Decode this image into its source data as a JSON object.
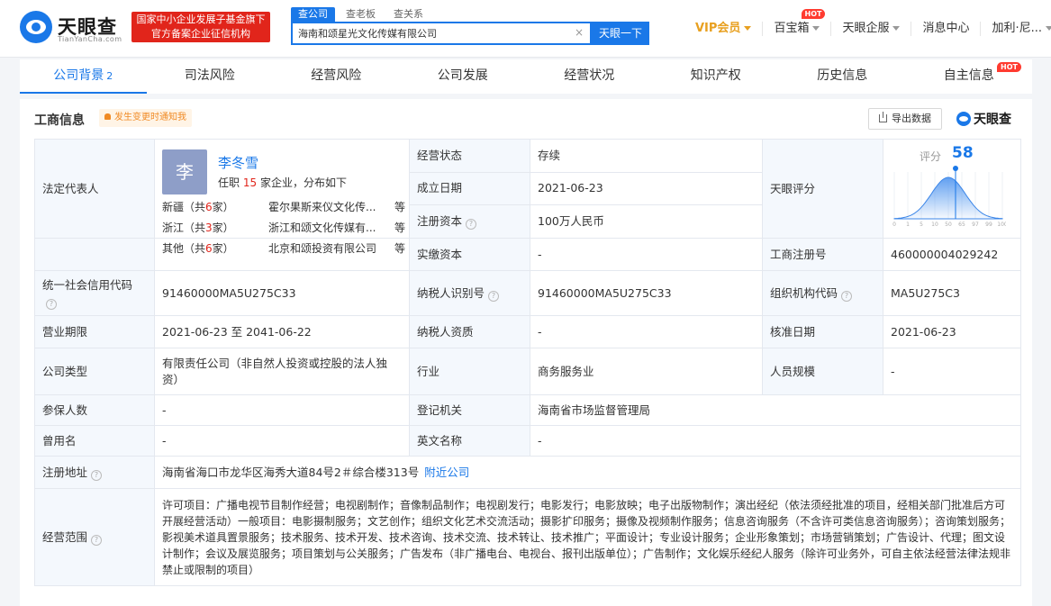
{
  "header": {
    "logo_name": "天眼查",
    "logo_sub": "TianYanCha.com",
    "badge_line1": "国家中小企业发展子基金旗下",
    "badge_line2": "官方备案企业征信机构",
    "search_tabs": [
      "查公司",
      "查老板",
      "查关系"
    ],
    "search_value": "海南和颂星光文化传媒有限公司",
    "search_button": "天眼一下",
    "nav": [
      {
        "label": "VIP会员"
      },
      {
        "label": "百宝箱",
        "badge": "HOT"
      },
      {
        "label": "天眼企服"
      },
      {
        "label": "消息中心"
      },
      {
        "label": "加利·尼..."
      }
    ]
  },
  "tabs": [
    {
      "label": "公司背景",
      "count": "2"
    },
    {
      "label": "司法风险"
    },
    {
      "label": "经营风险"
    },
    {
      "label": "公司发展"
    },
    {
      "label": "经营状况"
    },
    {
      "label": "知识产权"
    },
    {
      "label": "历史信息"
    },
    {
      "label": "自主信息",
      "badge": "HOT"
    }
  ],
  "section": {
    "title": "工商信息",
    "notice": "发生变更时通知我",
    "export_label": "导出数据",
    "brand": "天眼查"
  },
  "legal_rep": {
    "label": "法定代表人",
    "avatar_char": "李",
    "name": "李冬雪",
    "prefix": "任职",
    "count": "15",
    "suffix": "家企业，分布如下",
    "regions": [
      {
        "name": "新疆（共",
        "num": "6",
        "tail": "家）",
        "company": "霍尔果斯来仪文化传...",
        "more": "等"
      },
      {
        "name": "浙江（共",
        "num": "3",
        "tail": "家）",
        "company": "浙江和颂文化传媒有...",
        "more": "等"
      },
      {
        "name": "其他（共",
        "num": "6",
        "tail": "家）",
        "company": "北京和颂投资有限公司",
        "more": "等"
      }
    ]
  },
  "fields": {
    "status_label": "经营状态",
    "status_value": "存续",
    "found_label": "成立日期",
    "found_value": "2021-06-23",
    "capital_label": "注册资本",
    "capital_value": "100万人民币",
    "paid_label": "实缴资本",
    "paid_value": "-",
    "score_label_cell": "天眼评分",
    "reg_no_label": "工商注册号",
    "reg_no_value": "460000004029242",
    "credit_label": "统一社会信用代码",
    "credit_value": "91460000MA5U275C33",
    "taxid_label": "纳税人识别号",
    "taxid_value": "91460000MA5U275C33",
    "orgcode_label": "组织机构代码",
    "orgcode_value": "MA5U275C3",
    "term_label": "营业期限",
    "term_value": "2021-06-23  至 2041-06-22",
    "taxpayer_label": "纳税人资质",
    "taxpayer_value": "-",
    "approve_label": "核准日期",
    "approve_value": "2021-06-23",
    "type_label": "公司类型",
    "type_value": "有限责任公司（非自然人投资或控股的法人独资）",
    "industry_label": "行业",
    "industry_value": "商务服务业",
    "staff_label": "人员规模",
    "staff_value": "-",
    "insured_label": "参保人数",
    "insured_value": "-",
    "authority_label": "登记机关",
    "authority_value": "海南省市场监督管理局",
    "former_label": "曾用名",
    "former_value": "-",
    "english_label": "英文名称",
    "english_value": "-",
    "address_label": "注册地址",
    "address_value": "海南省海口市龙华区海秀大道84号2＃综合楼313号",
    "nearby": "附近公司",
    "scope_label": "经营范围",
    "scope_value": "许可项目：广播电视节目制作经营；电视剧制作；音像制品制作；电视剧发行；电影发行；电影放映；电子出版物制作；演出经纪（依法须经批准的项目，经相关部门批准后方可开展经营活动）一般项目：电影摄制服务；文艺创作；组织文化艺术交流活动；摄影扩印服务；摄像及视频制作服务；信息咨询服务（不含许可类信息咨询服务）；咨询策划服务；影视美术道具置景服务；技术服务、技术开发、技术咨询、技术交流、技术转让、技术推广；平面设计；专业设计服务；企业形象策划；市场营销策划；广告设计、代理；图文设计制作；会议及展览服务；项目策划与公关服务；广告发布（非广播电台、电视台、报刊出版单位）；广告制作；文化娱乐经纪人服务（除许可业务外，可自主依法经营法律法规非禁止或限制的项目）"
  },
  "score": {
    "label": "评分",
    "value": 58,
    "ticks": [
      "0",
      "1",
      "5",
      "10",
      "50",
      "65",
      "97",
      "99",
      "100"
    ]
  },
  "colors": {
    "primary": "#1a78e8",
    "red": "#e1251b",
    "label_bg": "#f4f8fd",
    "notice": "#f08a24"
  }
}
